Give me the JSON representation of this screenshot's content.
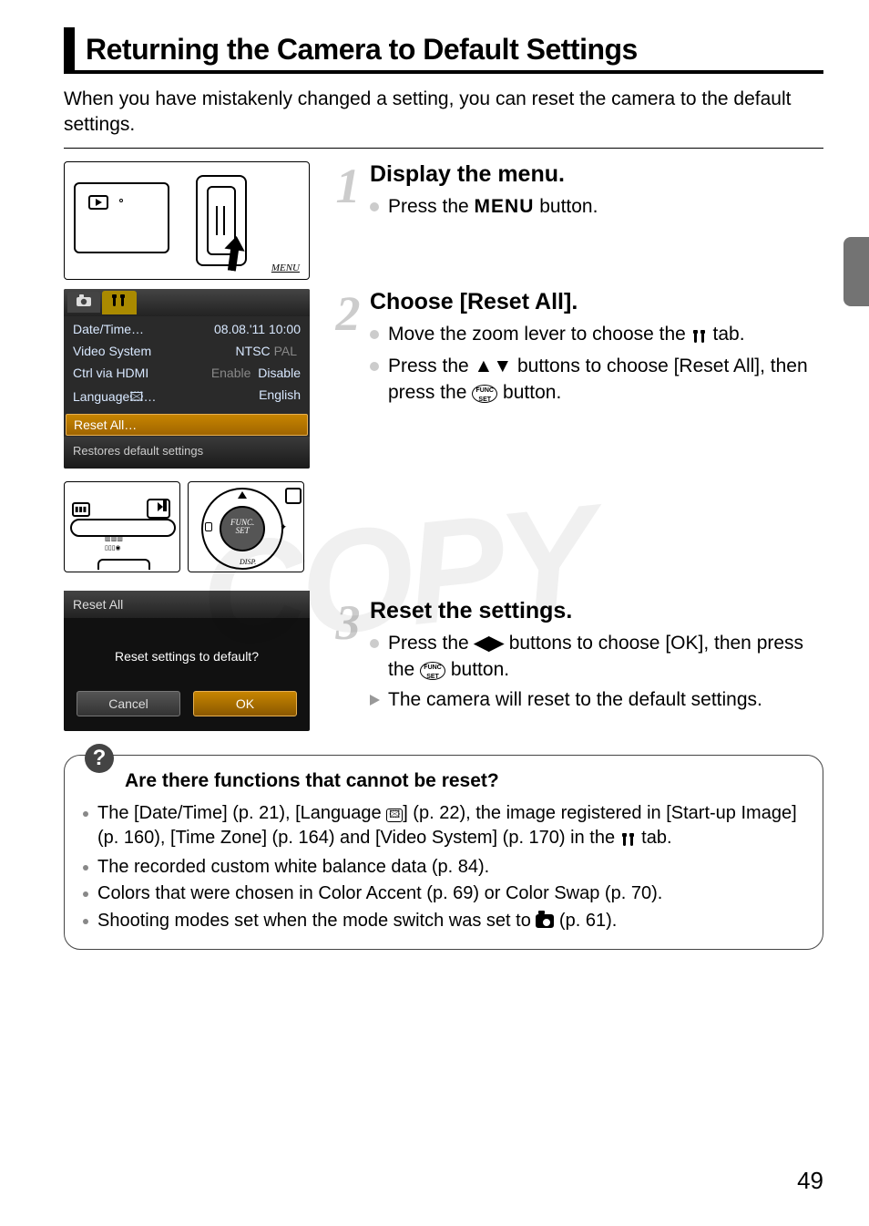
{
  "page": {
    "title": "Returning the Camera to Default Settings",
    "intro": "When you have mistakenly changed a setting, you can reset the camera to the default settings.",
    "page_number": "49",
    "watermark": "COPY"
  },
  "icons": {
    "menu_word": "MENU",
    "func_set_top": "FUNC",
    "func_set_bot": "SET",
    "arrows_ud": "▲▼",
    "arrows_lr": "◀▶",
    "tools": "⚒",
    "camera_tab": "📷"
  },
  "steps": [
    {
      "num": "1",
      "title": "Display the menu.",
      "bullets": [
        {
          "type": "dot",
          "pre": "Press the ",
          "icon": "menu",
          "post": " button."
        }
      ],
      "illus_labels": {
        "menu": "MENU"
      }
    },
    {
      "num": "2",
      "title": "Choose [Reset All].",
      "bullets": [
        {
          "type": "dot",
          "pre": "Move the zoom lever to choose the ",
          "icon": "tools",
          "post": " tab."
        },
        {
          "type": "dot",
          "pre": "Press the ",
          "icon": "ud",
          "post": " buttons to choose [Reset All], then press the ",
          "icon2": "func",
          "post2": " button."
        }
      ],
      "menu": {
        "rows": [
          {
            "label": "Date/Time…",
            "value": "08.08.'11 10:00"
          },
          {
            "label": "Video System",
            "value": "NTSC",
            "disabled_hint": "PAL"
          },
          {
            "label": "Ctrl via HDMI",
            "value": "Disable",
            "disabled_hint": "Enable"
          },
          {
            "label": "Language🖾…",
            "value": "English"
          },
          {
            "label": "Reset All…",
            "selected": true
          }
        ],
        "footer": "Restores default settings"
      },
      "mini_labels": {
        "func": "FUNC.\nSET",
        "disp": "DISP."
      }
    },
    {
      "num": "3",
      "title": "Reset the settings.",
      "bullets": [
        {
          "type": "dot",
          "pre": "Press the ",
          "icon": "lr",
          "post": " buttons to choose [OK], then press the ",
          "icon2": "func",
          "post2": " button."
        },
        {
          "type": "tri",
          "text": "The camera will reset to the default settings."
        }
      ],
      "dialog": {
        "title": "Reset All",
        "body": "Reset settings to default?",
        "cancel": "Cancel",
        "ok": "OK"
      }
    }
  ],
  "tip": {
    "title": "Are there functions that cannot be reset?",
    "items": [
      "The [Date/Time] (p. 21), [Language 🖾] (p. 22), the image registered in [Start-up Image] (p. 160), [Time Zone] (p. 164) and [Video System] (p. 170) in the ⚒ tab.",
      "The recorded custom white balance data (p. 84).",
      "Colors that were chosen in Color Accent (p. 69) or Color Swap (p. 70).",
      "Shooting modes set when the mode switch was set to 📷 (p. 61)."
    ]
  }
}
